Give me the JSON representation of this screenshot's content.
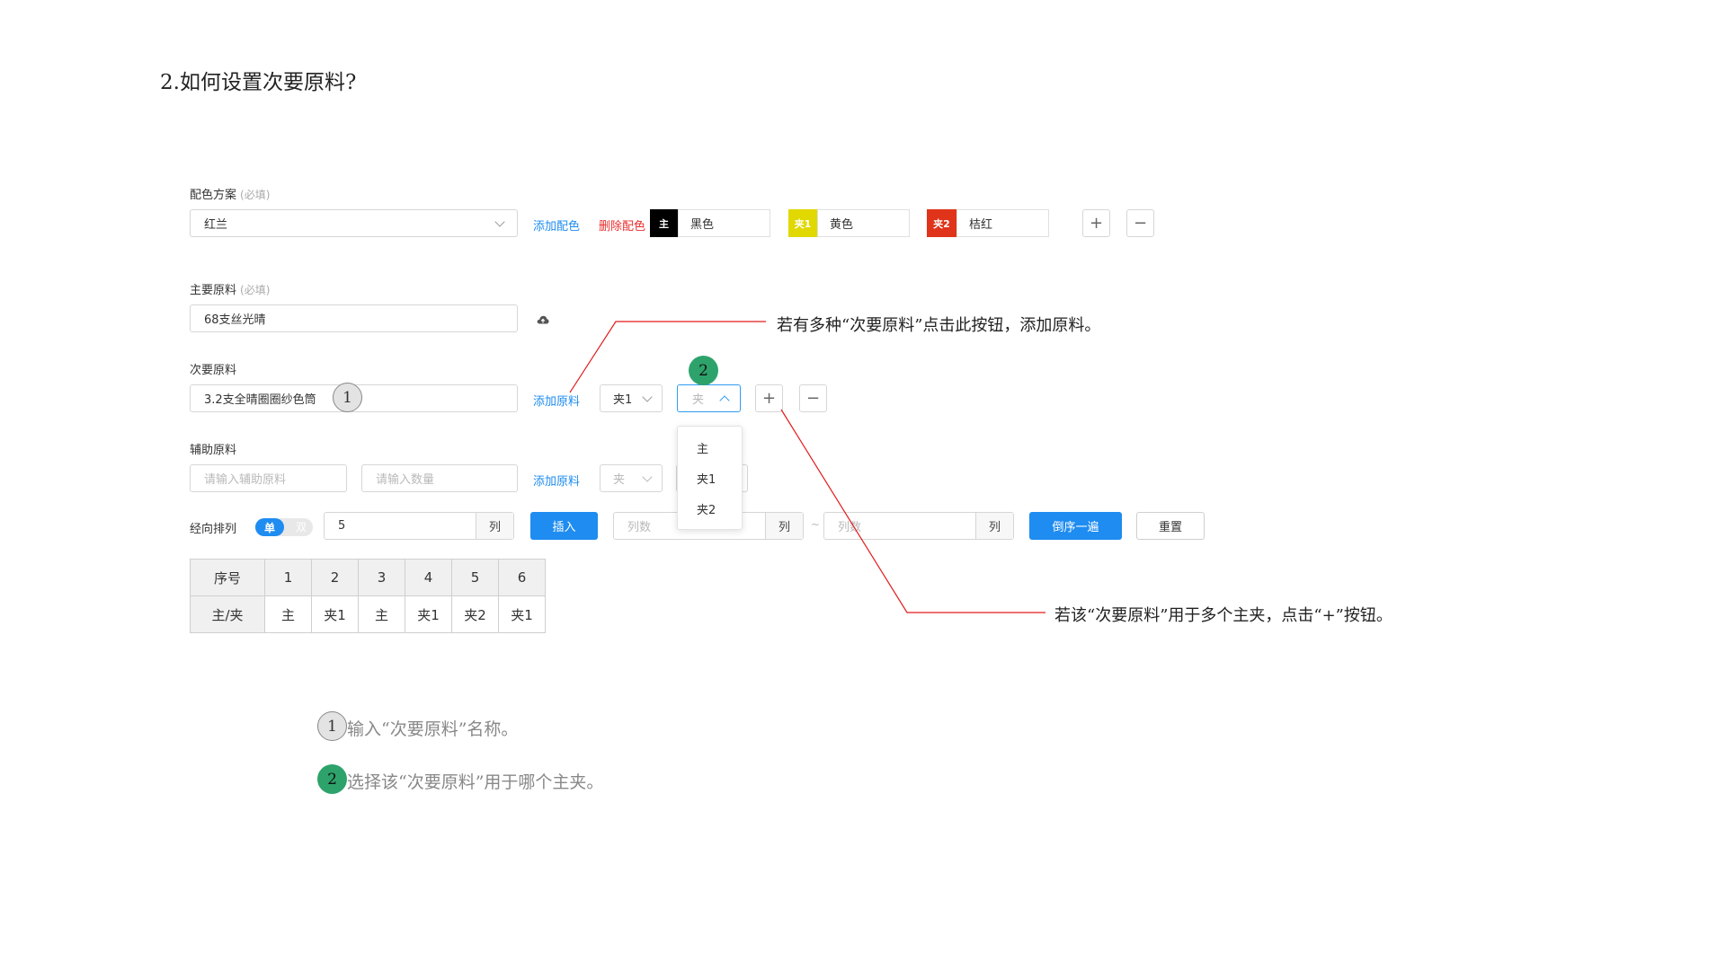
{
  "page": {
    "title": "2.如何设置次要原料?"
  },
  "color_scheme": {
    "label": "配色方案",
    "hint": "(必填)",
    "value": "红兰",
    "add_link": "添加配色",
    "delete_link": "删除配色",
    "colors": [
      {
        "tag": "主",
        "name": "黑色",
        "tag_bg": "#000000"
      },
      {
        "tag": "夹1",
        "name": "黄色",
        "tag_bg": "#e1d800"
      },
      {
        "tag": "夹2",
        "name": "桔红",
        "tag_bg": "#e0341a"
      }
    ],
    "plus": "+",
    "minus": "−"
  },
  "main_material": {
    "label": "主要原料",
    "hint": "(必填)",
    "value": "68支丝光晴",
    "icon": "cloud-upload-icon"
  },
  "secondary_material": {
    "label": "次要原料",
    "value": "3.2支全晴圈圈纱色筒",
    "add_link": "添加原料",
    "select_value": "夹1",
    "select_open_placeholder": "夹",
    "options": [
      "主",
      "夹1",
      "夹2"
    ],
    "plus": "+",
    "minus": "−"
  },
  "auxiliary_material": {
    "label": "辅助原料",
    "name_placeholder": "请输入辅助原料",
    "qty_placeholder": "请输入数量",
    "add_link": "添加原料",
    "select_placeholder": "夹"
  },
  "warp": {
    "label": "经向排列",
    "toggle_on": "单",
    "toggle_off": "双",
    "count_value": "5",
    "unit": "列",
    "insert_button": "插入",
    "from_placeholder": "列数",
    "to_placeholder": "列数",
    "tilde": "~",
    "reverse_button": "倒序一遍",
    "reset_button": "重置"
  },
  "table": {
    "header_label": "序号",
    "row_label": "主/夹",
    "numbers": [
      "1",
      "2",
      "3",
      "4",
      "5",
      "6"
    ],
    "values": [
      "主",
      "夹1",
      "主",
      "夹1",
      "夹2",
      "夹1"
    ]
  },
  "annotations": {
    "badge1": "1",
    "badge2": "2",
    "callout_add": "若有多种“次要原料”点击此按钮，添加原料。",
    "callout_plus": "若该“次要原料”用于多个主夹，点击“+”按钮。",
    "legend1": "输入“次要原料”名称。",
    "legend2": "选择该“次要原料”用于哪个主夹。"
  },
  "colors": {
    "accent": "#1e8cf0",
    "danger": "#ea2e2e",
    "badge_green": "#2da36b",
    "callout_line": "#e31b1b"
  }
}
